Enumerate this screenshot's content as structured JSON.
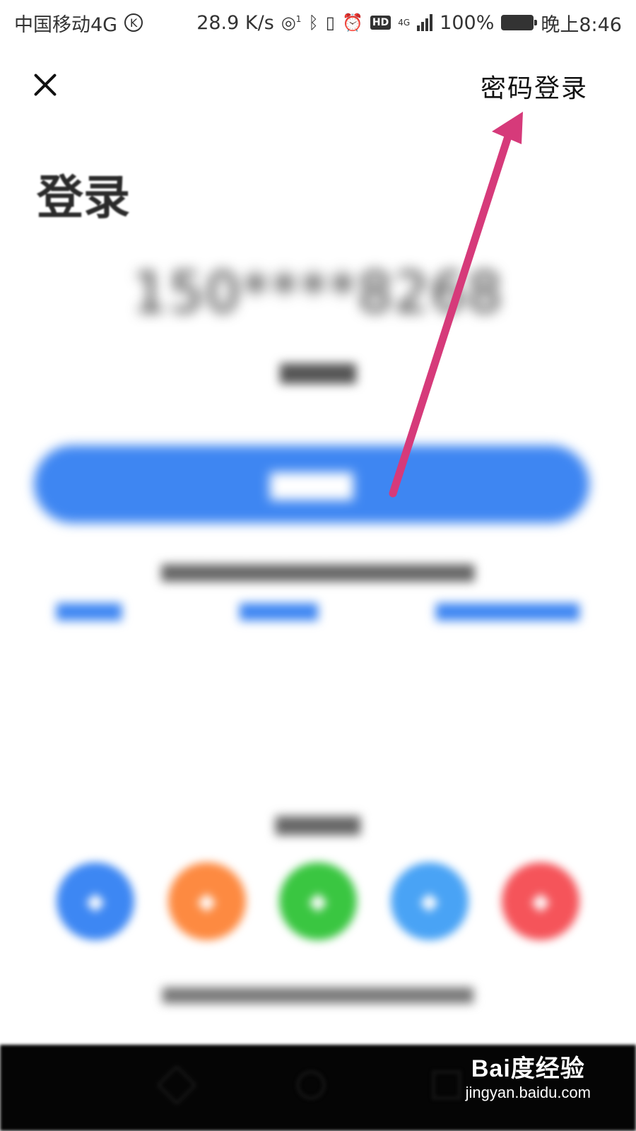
{
  "status_bar": {
    "carrier": "中国移动4G",
    "carrier_badge": "K",
    "speed": "28.9 K/s",
    "hotspot_count": "1",
    "hd_label": "HD",
    "network_type": "4G",
    "battery": "100%",
    "time": "晚上8:46"
  },
  "header": {
    "close_icon": "close-icon",
    "password_login": "密码登录"
  },
  "page": {
    "title": "登录",
    "phone_number": "150****8268"
  },
  "colors": {
    "primary": "#3e86f2",
    "annotation_arrow": "#d63a7a",
    "social": [
      "#3d87f3",
      "#fd8a41",
      "#3ac641",
      "#49a3f5",
      "#f5545a"
    ]
  },
  "social_icons": [
    "qq-icon",
    "weibo-icon",
    "wechat-icon",
    "phone-icon",
    "alipay-icon"
  ],
  "watermark": {
    "logo": "Bai度经验",
    "url": "jingyan.baidu.com"
  }
}
